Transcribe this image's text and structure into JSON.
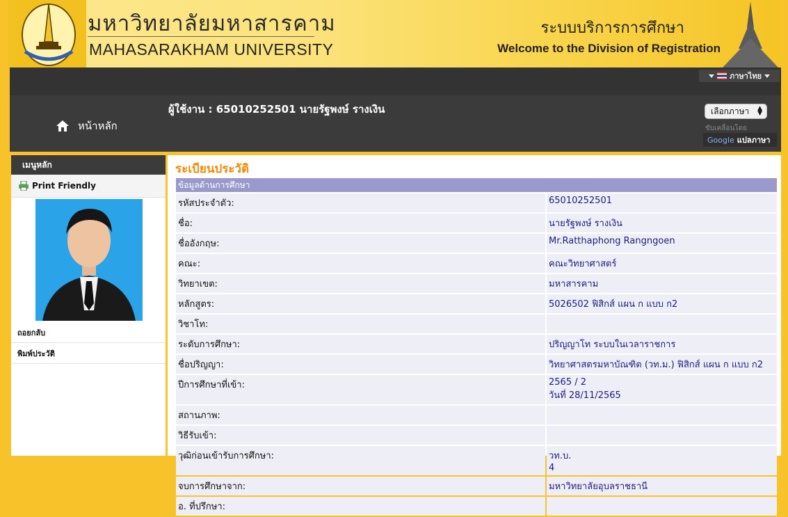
{
  "header": {
    "uni_th": "มหาวิทยาลัยมหาสารคาม",
    "uni_en": "MAHASARAKHAM UNIVERSITY",
    "reg_th": "ระบบบริการการศึกษา",
    "reg_en": "Welcome to the Division of Registration",
    "logo_icon": "university-seal-icon"
  },
  "topbar": {
    "language_label": "ภาษาไทย"
  },
  "nav": {
    "home_label": "หน้าหลัก",
    "user_text": "ผู้ใช้งาน : 65010252501 นายรัฐพงษ์ รางเงิน",
    "lang_select": "เลือกภาษา",
    "powered_by": "ขับเคลื่อนโดย",
    "google_text": "Google",
    "translate_label": "แปลภาษา"
  },
  "sidebar": {
    "title": "เมนูหลัก",
    "print_friendly": "Print Friendly",
    "links": [
      "ถอยกลับ",
      "พิมพ์ประวัติ"
    ]
  },
  "main": {
    "title": "ระเบียนประวัติ",
    "section": "ข้อมูลด้านการศึกษา",
    "rows": [
      {
        "label": "รหัสประจำตัว:",
        "value": "65010252501"
      },
      {
        "label": "ชื่อ:",
        "value": "นายรัฐพงษ์ รางเงิน"
      },
      {
        "label": "ชื่ออังกฤษ:",
        "value": "Mr.Ratthaphong Rangngoen"
      },
      {
        "label": "คณะ:",
        "value": "คณะวิทยาศาสตร์"
      },
      {
        "label": "วิทยาเขต:",
        "value": "มหาสารคาม"
      },
      {
        "label": "หลักสูตร:",
        "value": "5026502 ฟิสิกส์ แผน ก แบบ ก2"
      },
      {
        "label": "วิชาโท:",
        "value": ""
      },
      {
        "label": "ระดับการศึกษา:",
        "value": "ปริญญาโท ระบบในเวลาราชการ"
      },
      {
        "label": "ชื่อปริญญา:",
        "value": "วิทยาศาสตรมหาบัณฑิต (วท.ม.) ฟิสิกส์ แผน ก แบบ ก2"
      },
      {
        "label": "ปีการศึกษาที่เข้า:",
        "value": "2565 / 2\nวันที่ 28/11/2565"
      },
      {
        "label": "สถานภาพ:",
        "value": ""
      },
      {
        "label": "วิธีรับเข้า:",
        "value": ""
      },
      {
        "label": "วุฒิก่อนเข้ารับการศึกษา:",
        "value": "วท.บ.\n4"
      },
      {
        "label": "จบการศึกษาจาก:",
        "value": "มหาวิทยาลัยอุบลราชธานี"
      },
      {
        "label": "อ. ที่ปรึกษา:",
        "value": ""
      }
    ]
  }
}
